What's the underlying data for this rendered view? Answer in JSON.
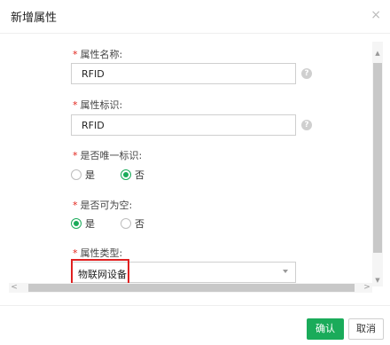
{
  "dialog": {
    "title": "新增属性",
    "close_glyph": "×"
  },
  "form": {
    "required_mark": "*",
    "attr_name": {
      "label": "属性名称:",
      "value": "RFID",
      "help_icon": "?"
    },
    "attr_id": {
      "label": "属性标识:",
      "value": "RFID",
      "help_icon": "?"
    },
    "unique": {
      "label": "是否唯一标识:",
      "options": [
        "是",
        "否"
      ],
      "selected": "否"
    },
    "nullable": {
      "label": "是否可为空:",
      "options": [
        "是",
        "否"
      ],
      "selected": "是"
    },
    "attr_type": {
      "label": "属性类型:",
      "value": "物联网设备"
    }
  },
  "scrollbars": {
    "up_glyph": "▲",
    "down_glyph": "▼",
    "left_glyph": "<",
    "right_glyph": ">"
  },
  "footer": {
    "confirm_label": "确认",
    "cancel_label": "取消"
  },
  "colors": {
    "accent": "#1aab5a",
    "required": "#e2231a",
    "highlight": "#e02020"
  }
}
